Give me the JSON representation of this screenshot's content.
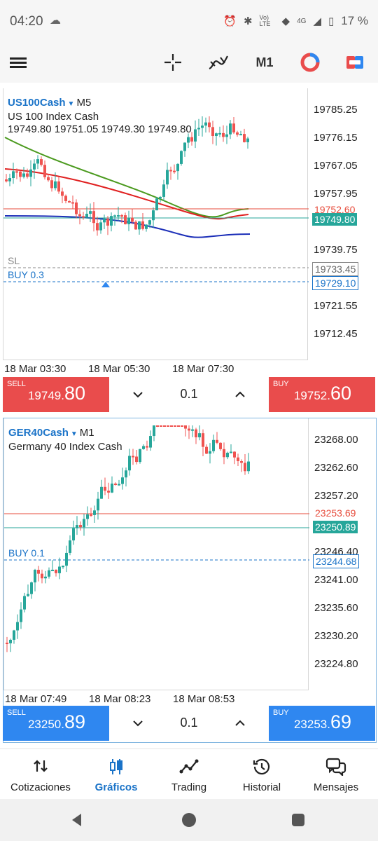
{
  "status_bar": {
    "time": "04:20",
    "battery": "17 %",
    "network": "4G",
    "lte_label": "Vo) LTE"
  },
  "toolbar": {
    "timeframe": "M1",
    "icons": [
      "menu-icon",
      "crosshair-icon",
      "indicators-icon",
      "one-click-trading-icon",
      "trade-icon"
    ]
  },
  "chart1": {
    "symbol": "US100Cash",
    "timeframe": "M5",
    "description": "US 100 Index Cash",
    "ohlc": "19749.80 19751.05 19749.30 19749.80",
    "sl_label": "SL",
    "buy_label": "BUY 0.3",
    "price_ticks": [
      "19785.25",
      "19776.15",
      "19767.05",
      "19757.95",
      "19739.75",
      "19721.55",
      "19712.45"
    ],
    "tag_ask": "19752.60",
    "tag_bid": "19749.80",
    "tag_sl": "19733.45",
    "tag_buy": "19729.10",
    "time_ticks": [
      "18 Mar 03:30",
      "18 Mar 05:30",
      "18 Mar 07:30"
    ],
    "sell_label": "SELL",
    "sell_price_main": "19749.",
    "sell_price_big": "80",
    "buy_btn_label": "BUY",
    "buy_price_main": "19752.",
    "buy_price_big": "60",
    "volume": "0.1",
    "colors": {
      "bull": "#26a69a",
      "bear": "#ef5350",
      "ma_green": "#4b9a1e",
      "ma_red": "#e02020",
      "ma_blue": "#1c2fb8"
    }
  },
  "chart2": {
    "symbol": "GER40Cash",
    "timeframe": "M1",
    "description": "Germany 40 Index Cash",
    "buy_label": "BUY 0.1",
    "price_ticks": [
      "23268.00",
      "23262.60",
      "23257.20",
      "23246.40",
      "23241.00",
      "23235.60",
      "23230.20",
      "23224.80"
    ],
    "tag_ask": "23253.69",
    "tag_bid": "23250.89",
    "tag_buy": "23244.68",
    "time_ticks": [
      "18 Mar 07:49",
      "18 Mar 08:23",
      "18 Mar 08:53"
    ],
    "sell_label": "SELL",
    "sell_price_main": "23250.",
    "sell_price_big": "89",
    "buy_btn_label": "BUY",
    "buy_price_main": "23253.",
    "buy_price_big": "69",
    "volume": "0.1"
  },
  "bottom_nav": {
    "items": [
      {
        "label": "Cotizaciones",
        "icon": "quotes-icon"
      },
      {
        "label": "Gráficos",
        "icon": "charts-icon",
        "active": true
      },
      {
        "label": "Trading",
        "icon": "trading-icon"
      },
      {
        "label": "Historial",
        "icon": "history-icon"
      },
      {
        "label": "Mensajes",
        "icon": "messages-icon"
      }
    ]
  }
}
